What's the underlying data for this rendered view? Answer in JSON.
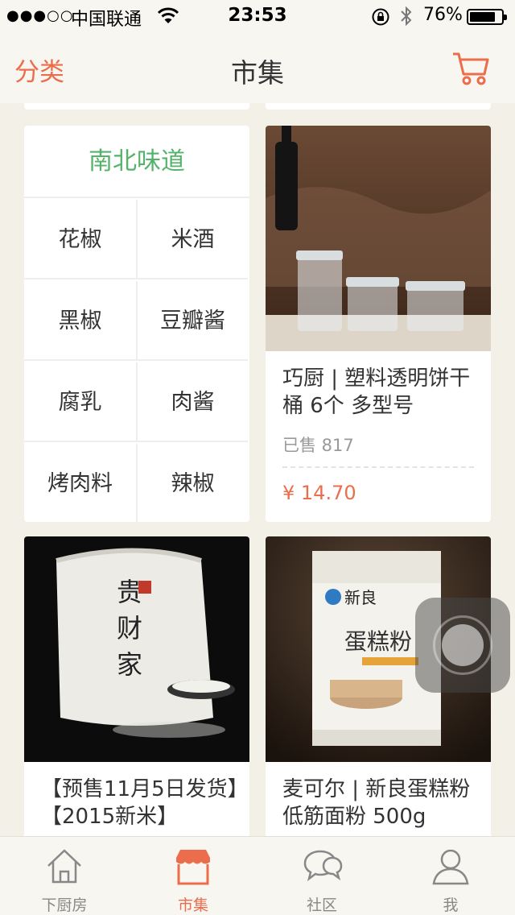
{
  "status_bar": {
    "signal": "●●●○○",
    "carrier": "中国联通",
    "time": "23:53",
    "battery": "76%"
  },
  "nav": {
    "left": "分类",
    "title": "市集",
    "cart_icon": "cart-icon"
  },
  "category_card": {
    "title": "南北味道",
    "items": [
      "花椒",
      "米酒",
      "黑椒",
      "豆瓣酱",
      "腐乳",
      "肉酱",
      "烤肉料",
      "辣椒"
    ]
  },
  "products": [
    {
      "title": "巧厨 | 塑料透明饼干桶 6个 多型号",
      "sold": "已售 817",
      "price": "¥ 14.70"
    },
    {
      "title": "【预售11月5日发货】【2015新米】"
    },
    {
      "title": "麦可尔 | 新良蛋糕粉 低筋面粉 500g"
    }
  ],
  "tabs": [
    {
      "label": "下厨房",
      "icon": "home-icon"
    },
    {
      "label": "市集",
      "icon": "market-icon"
    },
    {
      "label": "社区",
      "icon": "chat-bubbles-icon"
    },
    {
      "label": "我",
      "icon": "person-icon"
    }
  ],
  "colors": {
    "accent": "#ec6d4b",
    "category_title": "#54b36a",
    "background": "#f3f0e8"
  }
}
